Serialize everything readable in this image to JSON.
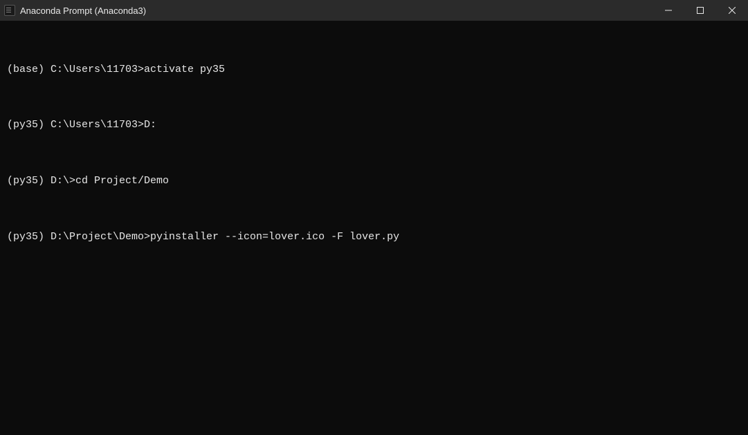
{
  "window": {
    "title": "Anaconda Prompt (Anaconda3)"
  },
  "terminal": {
    "lines": [
      "(base) C:\\Users\\11703>activate py35",
      "(py35) C:\\Users\\11703>D:",
      "(py35) D:\\>cd Project/Demo",
      "(py35) D:\\Project\\Demo>pyinstaller --icon=lover.ico -F lover.py"
    ]
  }
}
